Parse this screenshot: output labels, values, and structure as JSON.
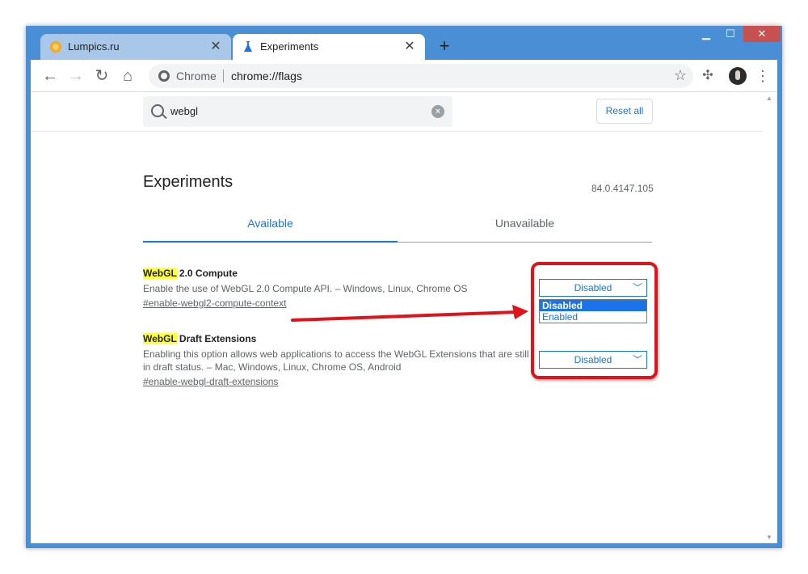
{
  "tabs": [
    {
      "title": "Lumpics.ru",
      "icon": "lumpics-icon",
      "active": false
    },
    {
      "title": "Experiments",
      "icon": "flask-icon",
      "active": true
    }
  ],
  "omnibox": {
    "site_label": "Chrome",
    "url": "chrome://flags"
  },
  "search": {
    "value": "webgl"
  },
  "reset_label": "Reset all",
  "page": {
    "title": "Experiments",
    "version": "84.0.4147.105",
    "tab_available": "Available",
    "tab_unavailable": "Unavailable"
  },
  "experiments": [
    {
      "title_highlight": "WebGL",
      "title_rest": " 2.0 Compute",
      "description": "Enable the use of WebGL 2.0 Compute API. – Windows, Linux, Chrome OS",
      "link": "#enable-webgl2-compute-context",
      "selected": "Disabled"
    },
    {
      "title_highlight": "WebGL",
      "title_rest": " Draft Extensions",
      "description": "Enabling this option allows web applications to access the WebGL Extensions that are still in draft status. – Mac, Windows, Linux, Chrome OS, Android",
      "link": "#enable-webgl-draft-extensions",
      "selected": "Disabled"
    }
  ],
  "dropdown_options": [
    "Disabled",
    "Enabled"
  ],
  "colors": {
    "accent": "#1a73e8",
    "annotation_red": "#e0121b",
    "search_highlight": "#ffff3a"
  }
}
